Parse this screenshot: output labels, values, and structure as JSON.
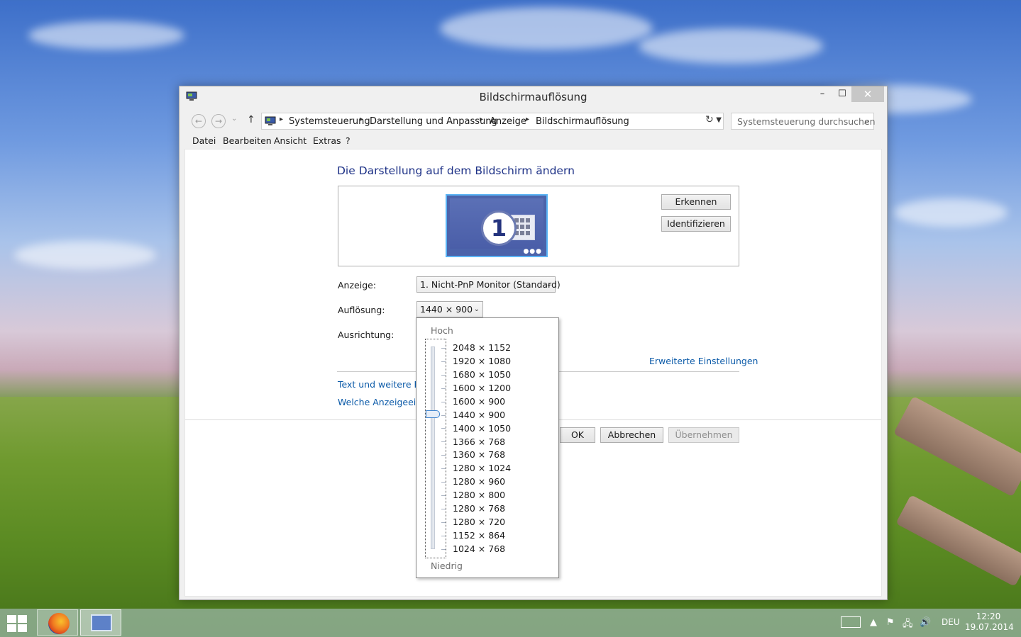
{
  "window": {
    "title": "Bildschirmauflösung",
    "minimize": "–",
    "maximize": "☐",
    "close": "✕"
  },
  "nav": {
    "back": "←",
    "forward": "→",
    "recent": "⌄",
    "up": "↑",
    "breadcrumbs": [
      "Systemsteuerung",
      "Darstellung und Anpassung",
      "Anzeige",
      "Bildschirmauflösung"
    ],
    "search_placeholder": "Systemsteuerung durchsuchen"
  },
  "menu": [
    "Datei",
    "Bearbeiten",
    "Ansicht",
    "Extras",
    "?"
  ],
  "main": {
    "heading": "Die Darstellung auf dem Bildschirm ändern",
    "monitor_number": "1",
    "detect_button": "Erkennen",
    "identify_button": "Identifizieren",
    "display_label": "Anzeige:",
    "display_value": "1. Nicht-PnP Monitor (Standard)",
    "resolution_label": "Auflösung:",
    "resolution_value": "1440 × 900",
    "orientation_label": "Ausrichtung:",
    "advanced_link": "Erweiterte Einstellungen",
    "text_link": "Text und weitere Elem",
    "which_link": "Welche Anzeigeeinst",
    "ok_button": "OK",
    "cancel_button": "Abbrechen",
    "apply_button": "Übernehmen"
  },
  "resolution_dropdown": {
    "high_label": "Hoch",
    "low_label": "Niedrig",
    "options": [
      "2048 × 1152",
      "1920 × 1080",
      "1680 × 1050",
      "1600 × 1200",
      "1600 × 900",
      "1440 × 900",
      "1400 × 1050",
      "1366 × 768",
      "1360 × 768",
      "1280 × 1024",
      "1280 × 960",
      "1280 × 800",
      "1280 × 768",
      "1280 × 720",
      "1152 × 864",
      "1024 × 768"
    ],
    "selected": "1440 × 900"
  },
  "taskbar": {
    "apps": [
      "firefox",
      "control-panel"
    ],
    "language": "DEU",
    "time": "12:20",
    "date": "19.07.2014"
  },
  "colors": {
    "heading": "#1e3287",
    "link": "#0b5aa8",
    "slider_thumb_border": "#3e84cf"
  }
}
